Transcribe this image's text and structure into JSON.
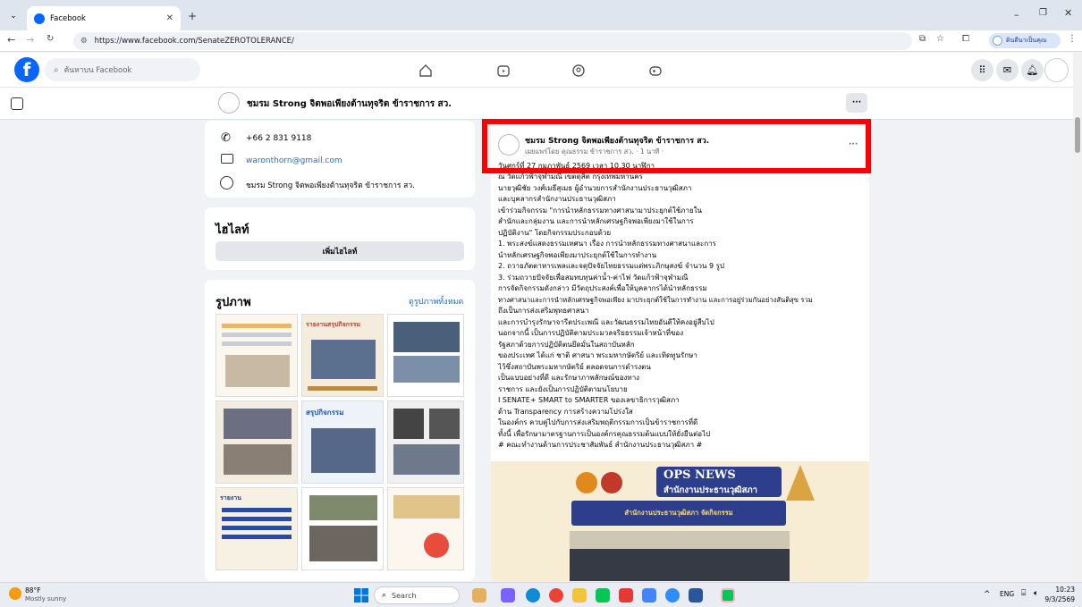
{
  "browser": {
    "tab_title": "Facebook",
    "url": "https://www.facebook.com/SenateZEROTOLERANCE/",
    "profile_label": "ดินดีนาเป็นคุณ"
  },
  "facebook": {
    "search_placeholder": "ค้นหาบน Facebook",
    "page_name": "ชมรม Strong จิตพอเพียงต้านทุจริต ข้าราชการ สว.",
    "more": "···"
  },
  "about": {
    "phone": "+66 2 831 9118",
    "email": "waronthorn@gmail.com",
    "messenger_name": "ชมรม Strong จิตพอเพียงต้านทุจริต ข้าราชการ สว."
  },
  "highlights": {
    "title": "ไฮไลท์",
    "add_button": "เพิ่มไฮไลท์"
  },
  "photos": {
    "title": "รูปภาพ",
    "see_all": "ดูรูปภาพทั้งหมด",
    "tile_captions": [
      "",
      "รายงานสรุปกิจกรรม",
      "",
      "",
      "สรุปกิจกรรม",
      "",
      "รายงาน",
      "",
      ""
    ]
  },
  "post": {
    "author": "ชมรม Strong จิตพอเพียงต้านทุจริต ข้าราชการ สว.",
    "meta": "เผยแพร่โดย คุณธรรม ข้าราชการ สว. · 1 นาที ·",
    "more": "···",
    "lines": [
      "วันศุกร์ที่ 27 กุมภาพันธ์ 2569 เวลา 10.30 นาฬิกา",
      "ณ วัดแก้วฟ้าจุฬามณี เขตดุสิต กรุงเทพมหานคร",
      "นายวุฒิชัย วงศ์เมธีสุเมธ ผู้อำนวยการสำนักงานประธานวุฒิสภา",
      "และบุคลากรสำนักงานประธานวุฒิสภา",
      "เข้าร่วมกิจกรรม \"การนำหลักธรรมทางศาสนามาประยุกต์ใช้ภายใน",
      "สำนักและกลุ่มงาน และการนำหลักเศรษฐกิจพอเพียงมาใช้ในการ",
      "ปฏิบัติงาน\" โดยกิจกรรมประกอบด้วย",
      "      1. พระสงฆ์แสดงธรรมเทศนา เรื่อง การนำหลักธรรมทางศาสนาและการ",
      "นำหลักเศรษฐกิจพอเพียงมาประยุกต์ใช้ในการทำงาน",
      "      2. ถวายภัตตาหารเพลและจตุปัจจัยไทยธรรมแด่พระภิกษุสงฆ์ จำนวน 9 รูป",
      "      3. ร่วมถวายปัจจัยเพื่อสมทบทุนค่าน้ำ-ค่าไฟ วัดแก้วฟ้าจุฬามณี",
      "      การจัดกิจกรรมดังกล่าว มีวัตถุประสงค์เพื่อให้บุคลากรได้นำหลักธรรม",
      "ทางศาสนาและการนำหลักเศรษฐกิจพอเพียง มาประยุกต์ใช้ในการทำงาน และการอยู่ร่วมกันอย่างสันติสุข รวม",
      "ถึงเป็นการส่งเสริมพุทธศาสนา",
      "และการบำรุงรักษาจารีตประเพณี และวัฒนธรรมไทยอันดีให้คงอยู่สืบไป",
      "นอกจากนี้ เป็นการปฏิบัติตามประมวลจริยธรรมเจ้าหน้าที่ของ",
      "รัฐสภาด้วยการปฏิบัติตนยึดมั่นในสถาบันหลัก",
      "ของประเทศ ได้แก่ ชาติ ศาสนา พระมหากษัตริย์ และเทิดทูนรักษา",
      "ไว้ซึ่งสถาบันพระมหากษัตริย์ ตลอดจนการดำรงตน",
      "เป็นแบบอย่างที่ดี และรักษาภาพลักษณ์ของทาง",
      "ราชการ และยังเป็นการปฏิบัติตามนโยบาย",
      "I SENATE+ SMART to SMARTER ของเลขาธิการวุฒิสภา",
      " ด้าน Transparency การสร้างความโปร่งใส",
      "ในองค์กร ควบคู่ไปกับการส่งเสริมพฤติกรรมการเป็นข้าราชการที่ดี",
      "ทั้งนี้ เพื่อรักษามาตรฐานการเป็นองค์กรคุณธรรมต้นแบบให้ยั่งยืนต่อไป",
      "# คณะทำงานด้านการประชาสัมพันธ์ สำนักงานประธานวุฒิสภา #"
    ],
    "banner_title": "OPS NEWS",
    "banner_subtitle": "สำนักงานประธานวุฒิสภา",
    "banner_strip": "สำนักงานประธานวุฒิสภา จัดกิจกรรม"
  },
  "taskbar": {
    "weather_temp": "88°F",
    "weather_desc": "Mostly sunny",
    "search": "Search",
    "lang": "ENG",
    "time": "10:23",
    "date": "9/3/2569"
  },
  "colors": {
    "fb_blue": "#0866ff",
    "highlight_red": "#ff0000",
    "banner_bg": "#f7ecd4",
    "banner_title": "#ffffff"
  }
}
